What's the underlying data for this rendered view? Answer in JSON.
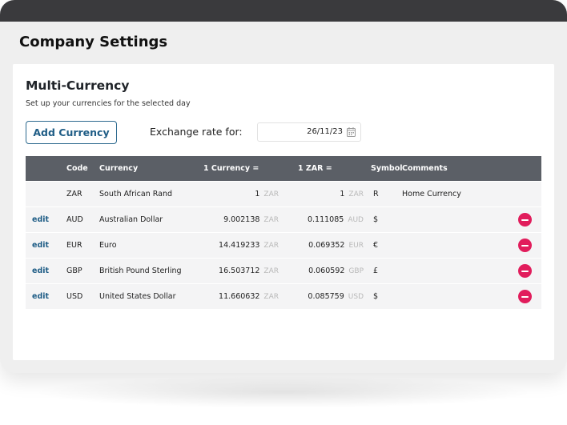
{
  "header": {
    "title": "Company Settings"
  },
  "section": {
    "title": "Multi-Currency",
    "subtitle": "Set up your currencies for the selected day",
    "add_button_label": "Add Currency",
    "exchange_label": "Exchange rate for:",
    "date_value": "26/11/23"
  },
  "table": {
    "headers": {
      "code": "Code",
      "currency": "Currency",
      "rate1": "1 Currency =",
      "rate2": "1 ZAR =",
      "symbol": "Symbol",
      "comments": "Comments"
    },
    "rows": [
      {
        "edit": "",
        "code": "ZAR",
        "currency": "South African Rand",
        "rate1": "1",
        "rate1_unit": "ZAR",
        "rate2": "1",
        "rate2_unit": "ZAR",
        "symbol": "R",
        "comments": "Home Currency",
        "removable": false
      },
      {
        "edit": "edit",
        "code": "AUD",
        "currency": "Australian Dollar",
        "rate1": "9.002138",
        "rate1_unit": "ZAR",
        "rate2": "0.111085",
        "rate2_unit": "AUD",
        "symbol": "$",
        "comments": "",
        "removable": true
      },
      {
        "edit": "edit",
        "code": "EUR",
        "currency": "Euro",
        "rate1": "14.419233",
        "rate1_unit": "ZAR",
        "rate2": "0.069352",
        "rate2_unit": "EUR",
        "symbol": "€",
        "comments": "",
        "removable": true
      },
      {
        "edit": "edit",
        "code": "GBP",
        "currency": "British Pound Sterling",
        "rate1": "16.503712",
        "rate1_unit": "ZAR",
        "rate2": "0.060592",
        "rate2_unit": "GBP",
        "symbol": "£",
        "comments": "",
        "removable": true
      },
      {
        "edit": "edit",
        "code": "USD",
        "currency": "United States Dollar",
        "rate1": "11.660632",
        "rate1_unit": "ZAR",
        "rate2": "0.085759",
        "rate2_unit": "USD",
        "symbol": "$",
        "comments": "",
        "removable": true
      }
    ]
  },
  "icons": {
    "date": "calendar-icon",
    "remove": "remove-circle-icon"
  },
  "colors": {
    "accent": "#1f5d86",
    "remove": "#e11d5c",
    "header_bg": "#5b5f66",
    "row_bg": "#f4f4f5",
    "topbar": "#3a3a3d"
  }
}
